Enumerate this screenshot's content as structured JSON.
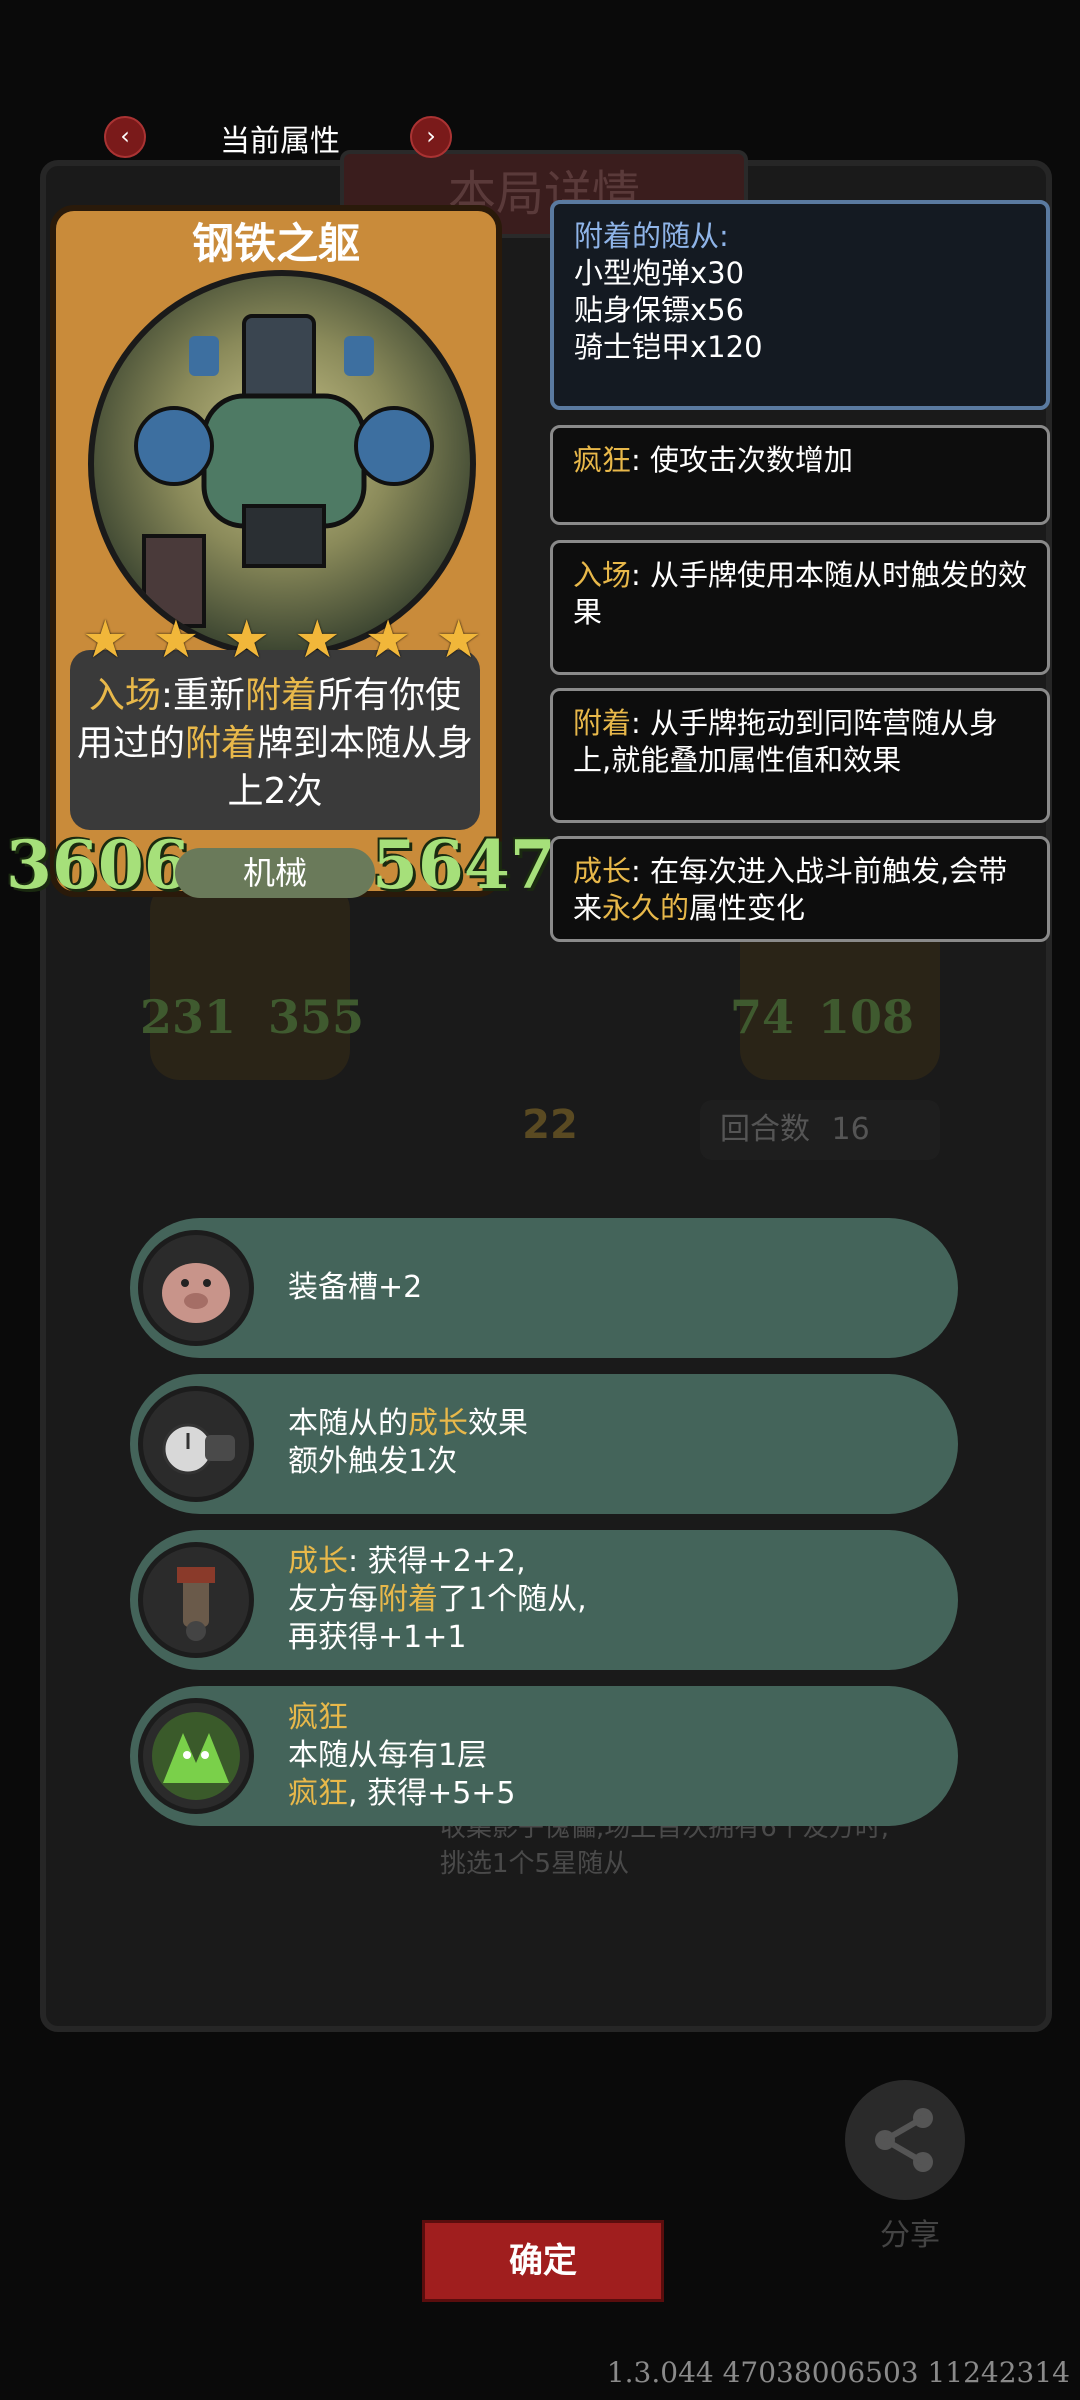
{
  "nav": {
    "title": "当前属性",
    "prev_icon": "chevron-left-icon",
    "next_icon": "chevron-right-icon"
  },
  "background": {
    "title": "本局详情",
    "stat_left_a": "231",
    "stat_left_b": "355",
    "stat_right_a": "74",
    "stat_right_b": "108",
    "turn_counter": "22",
    "round_label": "回合数",
    "round_value": "16",
    "desc_line1": "收集影子傀儡,场上首次拥有6个友方时,",
    "desc_line2": "挑选1个5星随从",
    "share_label": "分享"
  },
  "card": {
    "name": "钢铁之躯",
    "stars": 6,
    "effect_p1": "入场",
    "effect_p2": ":重新",
    "effect_p3": "附着",
    "effect_p4": "所有你使用过的",
    "effect_p5": "附着",
    "effect_p6": "牌到本随从身上2次",
    "attack": "3606",
    "tribe": "机械",
    "health": "5647"
  },
  "keywords": {
    "attached_title": "附着的随从:",
    "attached_items": [
      "小型炮弹x30",
      "贴身保镖x56",
      "骑士铠甲x120"
    ],
    "frenzy_term": "疯狂",
    "frenzy_desc": ": 使攻击次数增加",
    "battlecry_term": "入场",
    "battlecry_desc": ": 从手牌使用本随从时触发的效果",
    "attach_term": "附着",
    "attach_desc": ": 从手牌拖动到同阵营随从身上,就能叠加属性值和效果",
    "growth_term": "成长",
    "growth_desc_a": ": 在每次进入战斗前触发,会带来",
    "growth_desc_hl": "永久的",
    "growth_desc_b": "属性变化"
  },
  "modifiers": [
    {
      "icon": "pig-icon",
      "line1": "装备槽+2"
    },
    {
      "icon": "stopwatch-gauntlet-icon",
      "l1a": "本随从的",
      "l1b": "成长",
      "l1c": "效果",
      "line2": "额外触发1次"
    },
    {
      "icon": "mechanical-arm-icon",
      "l1a": "成长",
      "l1b": ": 获得+2+2,",
      "l2a": "友方每",
      "l2b": "附着",
      "l2c": "了1个随从,",
      "line3": "再获得+1+1"
    },
    {
      "icon": "green-beast-icon",
      "l1": "疯狂",
      "line2": "本随从每有1层",
      "l3a": "疯狂",
      "l3b": ", 获得+5+5"
    }
  ],
  "confirm_label": "确定",
  "version": "1.3.044 47038006503 11242314",
  "colors": {
    "highlight": "#e8b84a",
    "stat_green": "#a6e07a",
    "row_bg": "#44645a",
    "confirm_red": "#a01e1e"
  }
}
